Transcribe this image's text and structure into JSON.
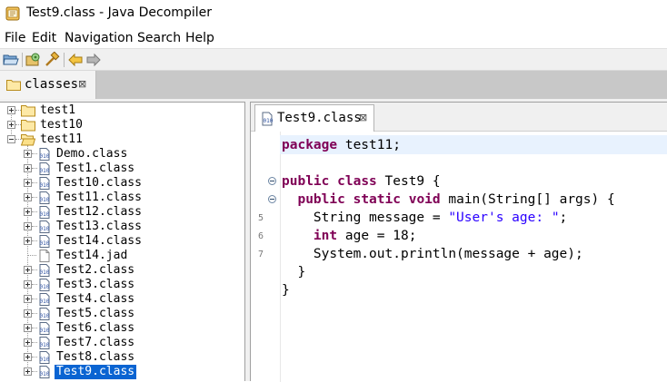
{
  "window": {
    "title": "Test9.class - Java Decompiler"
  },
  "menu": {
    "items": [
      "File",
      "Edit",
      "Navigation",
      "Search",
      "Help"
    ]
  },
  "toolbar": {
    "buttons": [
      "open-folder-icon",
      "open-type-icon",
      "search-hammer-icon",
      "back-arrow-icon",
      "forward-arrow-icon"
    ]
  },
  "outer_tab": {
    "label": "classes",
    "close": "⊠"
  },
  "tree": {
    "items": [
      {
        "label": "test1",
        "kind": "folder",
        "state": "collapsed",
        "level": 0
      },
      {
        "label": "test10",
        "kind": "folder",
        "state": "collapsed",
        "level": 0
      },
      {
        "label": "test11",
        "kind": "folder-open",
        "state": "expanded",
        "level": 0
      },
      {
        "label": "Demo.class",
        "kind": "class",
        "state": "collapsed",
        "level": 1
      },
      {
        "label": "Test1.class",
        "kind": "class",
        "state": "collapsed",
        "level": 1
      },
      {
        "label": "Test10.class",
        "kind": "class",
        "state": "collapsed",
        "level": 1
      },
      {
        "label": "Test11.class",
        "kind": "class",
        "state": "collapsed",
        "level": 1
      },
      {
        "label": "Test12.class",
        "kind": "class",
        "state": "collapsed",
        "level": 1
      },
      {
        "label": "Test13.class",
        "kind": "class",
        "state": "collapsed",
        "level": 1
      },
      {
        "label": "Test14.class",
        "kind": "class",
        "state": "collapsed",
        "level": 1
      },
      {
        "label": "Test14.jad",
        "kind": "file",
        "state": "none",
        "level": 1
      },
      {
        "label": "Test2.class",
        "kind": "class",
        "state": "collapsed",
        "level": 1
      },
      {
        "label": "Test3.class",
        "kind": "class",
        "state": "collapsed",
        "level": 1
      },
      {
        "label": "Test4.class",
        "kind": "class",
        "state": "collapsed",
        "level": 1
      },
      {
        "label": "Test5.class",
        "kind": "class",
        "state": "collapsed",
        "level": 1
      },
      {
        "label": "Test6.class",
        "kind": "class",
        "state": "collapsed",
        "level": 1
      },
      {
        "label": "Test7.class",
        "kind": "class",
        "state": "collapsed",
        "level": 1
      },
      {
        "label": "Test8.class",
        "kind": "class",
        "state": "collapsed",
        "level": 1
      },
      {
        "label": "Test9.class",
        "kind": "class",
        "state": "collapsed",
        "level": 1,
        "selected": true
      }
    ]
  },
  "editor": {
    "tab_label": "Test9.class",
    "tab_close": "⊠",
    "lines": [
      {
        "num": "",
        "fold": false,
        "tokens": [
          {
            "t": "package",
            "k": "kw"
          },
          {
            "t": " test11;",
            "k": ""
          }
        ]
      },
      {
        "num": "",
        "fold": false,
        "tokens": []
      },
      {
        "num": "",
        "fold": true,
        "tokens": [
          {
            "t": "public",
            "k": "kw"
          },
          {
            "t": " ",
            "k": ""
          },
          {
            "t": "class",
            "k": "kw"
          },
          {
            "t": " Test9 {",
            "k": ""
          }
        ]
      },
      {
        "num": "",
        "fold": true,
        "tokens": [
          {
            "t": "  ",
            "k": ""
          },
          {
            "t": "public",
            "k": "kw"
          },
          {
            "t": " ",
            "k": ""
          },
          {
            "t": "static",
            "k": "kw"
          },
          {
            "t": " ",
            "k": ""
          },
          {
            "t": "void",
            "k": "kw"
          },
          {
            "t": " main(String[] args) {",
            "k": ""
          }
        ]
      },
      {
        "num": "5",
        "fold": false,
        "tokens": [
          {
            "t": "    String message = ",
            "k": ""
          },
          {
            "t": "\"User's age: \"",
            "k": "str"
          },
          {
            "t": ";",
            "k": ""
          }
        ]
      },
      {
        "num": "6",
        "fold": false,
        "tokens": [
          {
            "t": "    ",
            "k": ""
          },
          {
            "t": "int",
            "k": "kw"
          },
          {
            "t": " age = 18;",
            "k": ""
          }
        ]
      },
      {
        "num": "7",
        "fold": false,
        "tokens": [
          {
            "t": "    System.out.println(message + age);",
            "k": ""
          }
        ]
      },
      {
        "num": "",
        "fold": false,
        "tokens": [
          {
            "t": "  }",
            "k": ""
          }
        ]
      },
      {
        "num": "",
        "fold": false,
        "tokens": [
          {
            "t": "}",
            "k": ""
          }
        ]
      }
    ]
  },
  "colors": {
    "keyword": "#7f0055",
    "string": "#2a00ff",
    "selection": "#0a64d2",
    "current_line": "#e8f2fe"
  }
}
